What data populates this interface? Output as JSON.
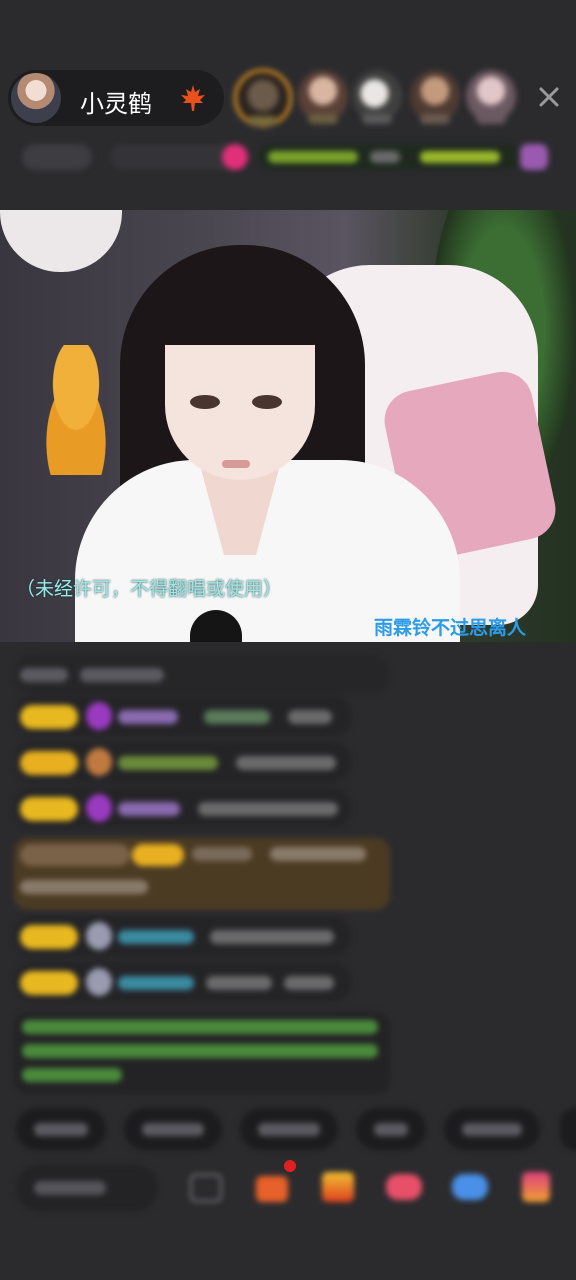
{
  "header": {
    "host_name": "小灵鹤",
    "host_avatar_icon": "avatar",
    "maple_icon": "maple-leaf-icon",
    "top_viewers": [
      "viewer-1",
      "viewer-2",
      "viewer-3",
      "viewer-4",
      "viewer-5"
    ],
    "close_icon": "close-icon"
  },
  "video": {
    "subtitle_left": "（未经许可，不得翻唱或使用）",
    "subtitle_right": "雨霖铃不过思离人",
    "colors": {
      "subtitle_left": "#9ee7e6",
      "subtitle_right": "#2c9be8"
    }
  },
  "chat": {
    "message_count": 8,
    "badge_color": "#e8b820",
    "gift_card_color": "#4c3b23",
    "notice_text_color": "#4caf50"
  },
  "quick_replies_count": 6,
  "toolbar": {
    "icons": [
      "keyboard-icon",
      "gift-box-icon",
      "popcorn-icon",
      "heart-gift-icon",
      "cloud-gift-icon",
      "more-gift-icon"
    ],
    "gift_notification_dot": "#e02020"
  }
}
